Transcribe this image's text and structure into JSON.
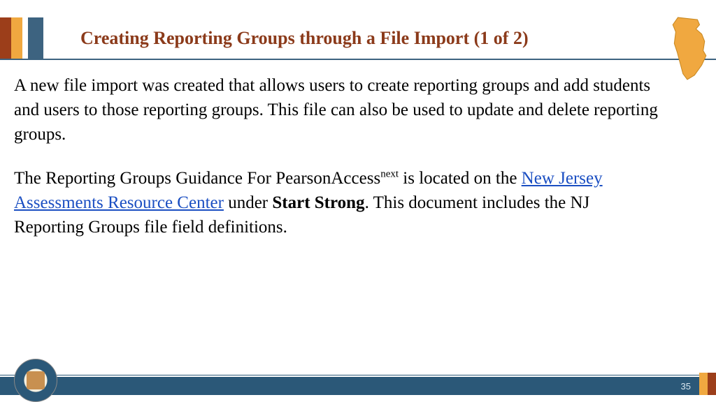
{
  "title": "Creating Reporting Groups through a File Import (1 of 2)",
  "para1": "A new file import was created that allows users to create reporting groups and add students and users to those reporting groups. This file can also be used to update and delete reporting groups.",
  "para2_prefix": "The Reporting Groups Guidance For PearsonAccess",
  "para2_sup": "next",
  "para2_mid": " is located on the ",
  "para2_link": "New Jersey Assessments Resource Center",
  "para2_under": " under ",
  "para2_bold": "Start Strong",
  "para2_suffix": ". This document includes the NJ Reporting Groups file field definitions.",
  "page_number": "35"
}
